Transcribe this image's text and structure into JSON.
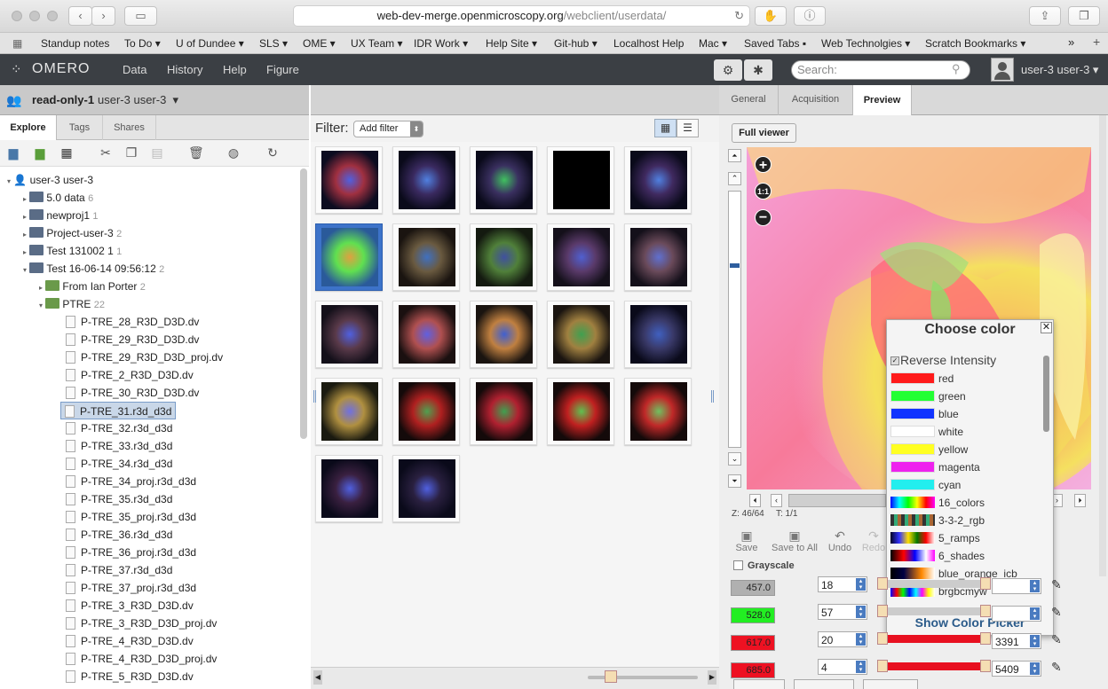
{
  "browser": {
    "url_host": "web-dev-merge.openmicroscopy.org",
    "url_path": "/webclient/userdata/",
    "bookmarks": [
      "Standup notes",
      "To Do",
      "U of Dundee",
      "SLS",
      "OME",
      "UX Team",
      "IDR Work",
      "Help Site",
      "Git-hub",
      "Localhost Help",
      "Mac",
      "Saved Tabs",
      "Web Technolgies",
      "Scratch Bookmarks"
    ],
    "more": "»"
  },
  "header": {
    "logo": "OMERO",
    "nav": [
      "Data",
      "History",
      "Help",
      "Figure"
    ],
    "search_placeholder": "Search:",
    "user": "user-3 user-3"
  },
  "group": {
    "name": "read-only-1",
    "user": "user-3 user-3"
  },
  "left_tabs": [
    "Explore",
    "Tags",
    "Shares"
  ],
  "tree": {
    "root": "user-3 user-3",
    "projects": [
      {
        "name": "5.0 data",
        "count": "6"
      },
      {
        "name": "newproj1",
        "count": "1"
      },
      {
        "name": "Project-user-3",
        "count": "2"
      },
      {
        "name": "Test 131002 1",
        "count": "1"
      },
      {
        "name": "Test 16-06-14 09:56:12",
        "count": "2"
      }
    ],
    "datasets": [
      {
        "name": "From Ian Porter",
        "count": "2"
      },
      {
        "name": "PTRE",
        "count": "22"
      }
    ],
    "images": [
      "P-TRE_28_R3D_D3D.dv",
      "P-TRE_29_R3D_D3D.dv",
      "P-TRE_29_R3D_D3D_proj.dv",
      "P-TRE_2_R3D_D3D.dv",
      "P-TRE_30_R3D_D3D.dv",
      "P-TRE_31.r3d_d3d",
      "P-TRE_32.r3d_d3d",
      "P-TRE_33.r3d_d3d",
      "P-TRE_34.r3d_d3d",
      "P-TRE_34_proj.r3d_d3d",
      "P-TRE_35.r3d_d3d",
      "P-TRE_35_proj.r3d_d3d",
      "P-TRE_36.r3d_d3d",
      "P-TRE_36_proj.r3d_d3d",
      "P-TRE_37.r3d_d3d",
      "P-TRE_37_proj.r3d_d3d",
      "P-TRE_3_R3D_D3D.dv",
      "P-TRE_3_R3D_D3D_proj.dv",
      "P-TRE_4_R3D_D3D.dv",
      "P-TRE_4_R3D_D3D_proj.dv",
      "P-TRE_5_R3D_D3D.dv"
    ],
    "selected": "P-TRE_31.r3d_d3d"
  },
  "filter": {
    "label": "Filter:",
    "button": "Add filter"
  },
  "right_tabs": [
    "General",
    "Acquisition",
    "Preview"
  ],
  "preview": {
    "full_viewer": "Full viewer",
    "z": "Z: 46/64",
    "t": "T: 1/1",
    "actions": [
      "Save",
      "Save to All",
      "Undo",
      "Redo"
    ],
    "grayscale": "Grayscale",
    "channels": [
      {
        "label": "457.0",
        "color": "#b0b0b0",
        "start": "18",
        "end": ""
      },
      {
        "label": "528.0",
        "color": "#22ee22",
        "start": "57",
        "end": ""
      },
      {
        "label": "617.0",
        "color": "#ee1122",
        "start": "20",
        "end": "3391"
      },
      {
        "label": "685.0",
        "color": "#ee1122",
        "start": "4",
        "end": "5409"
      }
    ]
  },
  "chooser": {
    "title": "Choose color",
    "reverse": "Reverse Intensity",
    "show_picker": "Show Color Picker",
    "colors": [
      {
        "name": "red",
        "swatch": "#ff1a1a"
      },
      {
        "name": "green",
        "swatch": "#22ff33"
      },
      {
        "name": "blue",
        "swatch": "#1133ff"
      },
      {
        "name": "white",
        "swatch": "#ffffff"
      },
      {
        "name": "yellow",
        "swatch": "#ffff22"
      },
      {
        "name": "magenta",
        "swatch": "#ee22ee"
      },
      {
        "name": "cyan",
        "swatch": "#22eeee"
      }
    ],
    "luts": [
      "16_colors",
      "3-3-2_rgb",
      "5_ramps",
      "6_shades",
      "blue_orange_icb",
      "brgbcmyw"
    ]
  }
}
